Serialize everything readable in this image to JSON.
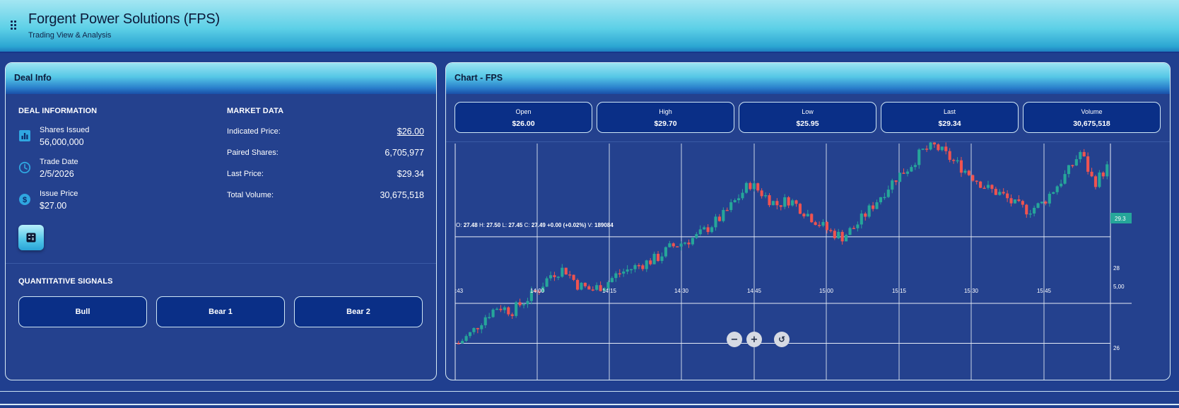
{
  "header": {
    "title": "Forgent Power Solutions (FPS)",
    "subtitle": "Trading View & Analysis"
  },
  "deal_panel": {
    "title": "Deal Info",
    "deal_section_title": "DEAL INFORMATION",
    "items": [
      {
        "label": "Shares Issued",
        "value": "56,000,000",
        "icon": "bar-chart-icon"
      },
      {
        "label": "Trade Date",
        "value": "2/5/2026",
        "icon": "clock-icon"
      },
      {
        "label": "Issue Price",
        "value": "$27.00",
        "icon": "dollar-icon"
      }
    ],
    "market_section_title": "MARKET DATA",
    "market": [
      {
        "label": "Indicated Price:",
        "value": "$26.00"
      },
      {
        "label": "Paired Shares:",
        "value": "6,705,977"
      },
      {
        "label": "Last Price:",
        "value": "$29.34"
      },
      {
        "label": "Total Volume:",
        "value": "30,675,518"
      }
    ],
    "signals_title": "QUANTITATIVE SIGNALS",
    "signals": [
      "Bull",
      "Bear 1",
      "Bear 2"
    ]
  },
  "chart_panel": {
    "title": "Chart - FPS",
    "stats": [
      {
        "label": "Open",
        "value": "$26.00"
      },
      {
        "label": "High",
        "value": "$29.70"
      },
      {
        "label": "Low",
        "value": "$25.95"
      },
      {
        "label": "Last",
        "value": "$29.34"
      },
      {
        "label": "Volume",
        "value": "30,675,518"
      }
    ],
    "legend": {
      "o_label": "O:",
      "o": "27.48",
      "h_label": "H:",
      "h": "27.50",
      "l_label": "L:",
      "l": "27.45",
      "c_label": "C:",
      "c": "27.49",
      "change": "+0.00 (+0.02%)",
      "v_label": "V:",
      "v": "189084"
    },
    "last_price_tag": "29.3",
    "volume_axis_label": "5,00",
    "colors": {
      "up": "#26a69a",
      "down": "#ef5350",
      "grid": "#e6ecf7"
    }
  },
  "chart_data": {
    "type": "candlestick",
    "x_ticks": [
      ":43",
      "14:00",
      "14:15",
      "14:30",
      "14:45",
      "15:00",
      "15:15",
      "15:30",
      "15:45"
    ],
    "y_ticks": [
      "28",
      "26"
    ],
    "ylim": [
      25.9,
      29.75
    ],
    "close_path": [
      26.0,
      26.2,
      26.5,
      26.7,
      26.6,
      26.8,
      27.0,
      27.3,
      27.4,
      27.1,
      27.0,
      27.1,
      27.3,
      27.4,
      27.5,
      27.6,
      27.8,
      27.9,
      28.0,
      28.2,
      28.4,
      28.7,
      29.0,
      28.8,
      28.6,
      28.7,
      28.5,
      28.3,
      28.1,
      28.0,
      28.2,
      28.5,
      28.8,
      29.1,
      29.3,
      29.6,
      29.7,
      29.5,
      29.3,
      29.1,
      28.9,
      28.8,
      28.6,
      28.5,
      28.6,
      28.9,
      29.2,
      29.6,
      29.0,
      29.3
    ],
    "candle_count": 170
  },
  "zoom_controls": {
    "zoom_out": "−",
    "zoom_in": "+",
    "reset": "↺"
  }
}
